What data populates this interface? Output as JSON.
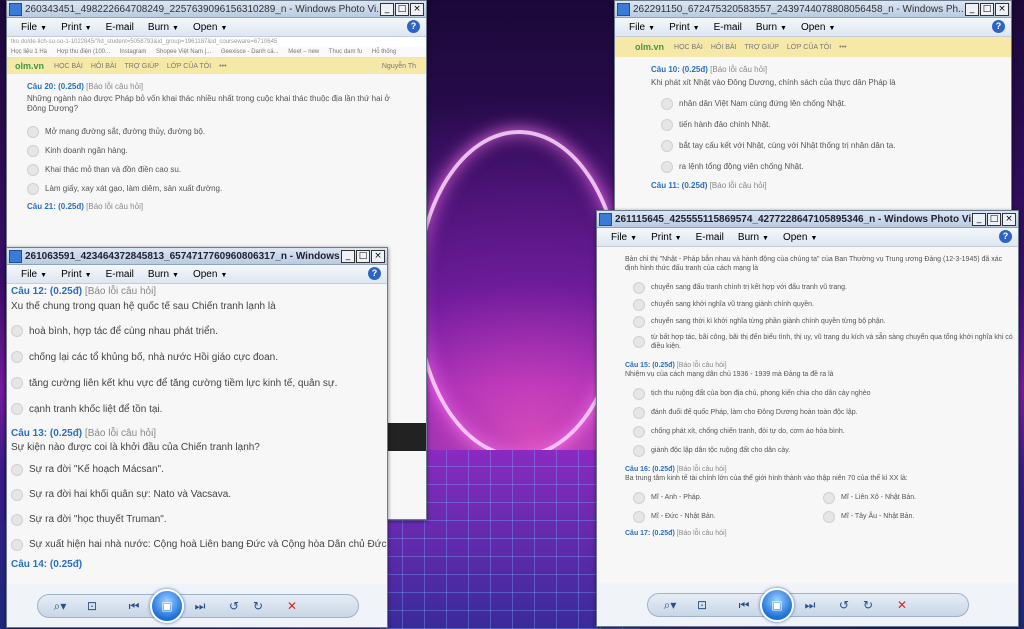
{
  "menu": {
    "file": "File",
    "print": "Print",
    "email": "E-mail",
    "burn": "Burn",
    "open": "Open",
    "help": "?"
  },
  "win1": {
    "title": "260343451_498222664708249_2257639096156310289_n - Windows Photo Vi...",
    "address": "tko do/de-lich-su-so-1-1022845/?id_student=5058793&id_group=1961187&id_courseware=6710645",
    "bookmarks": [
      "Học liệu 1 Hà",
      "Hợp thu điện (100...",
      "Instagram",
      "Shopee Việt Nam |...",
      "Geexisce - Danh cá...",
      "Meet – new",
      "Thuc dam fu",
      "Hỗ thống"
    ],
    "site": {
      "logo": "olm.vn",
      "items": [
        "HỌC BÀI",
        "HỎI BÀI",
        "TRỢ GIÚP",
        "LỚP CỦA TÔI",
        "•••"
      ],
      "user": "Nguyễn Th"
    },
    "q1_head": "Câu 20: (0.25đ)",
    "report": "[Báo lỗi câu hỏi]",
    "q1_text": "Những ngành nào được Pháp bỏ vốn khai thác nhiều nhất trong cuộc khai thác thuộc địa lần thứ hai ở Đông Dương?",
    "q1_opts": [
      "Mở mang đường sắt, đường thủy, đường bộ.",
      "Kinh doanh ngân hàng.",
      "Khai thác mỏ than và đồn điền cao su.",
      "Làm giấy, xay xát gạo, làm diêm, sản xuất đường."
    ],
    "q2_head": "Câu 21: (0.25đ)"
  },
  "win2": {
    "title": "261063591_423464372845813_6574717760960806317_n - Windows...",
    "q1_head": "Câu 12: (0.25đ)",
    "report": "[Báo lỗi câu hỏi]",
    "q1_text": "Xu thế chung trong quan hệ quốc tế sau Chiến tranh lạnh là",
    "q1_opts": [
      "hoà bình, hợp tác để cùng nhau phát triển.",
      "chống lại các tổ khủng bố, nhà nước Hồi giáo cực đoan.",
      "tăng cường liên kết khu vực để tăng cường tiềm lực kinh tế, quân sự.",
      "cạnh tranh khốc liệt để tồn tại."
    ],
    "q2_head": "Câu 13: (0.25đ)",
    "q2_text": "Sự kiện nào được coi là khởi đầu của Chiến tranh lạnh?",
    "q2_opts": [
      "Sự ra đời \"Kế hoạch Mácsan\".",
      "Sự ra đời hai khối quân sự: Nato và Vacsava.",
      "Sự ra đời \"học thuyết Truman\".",
      "Sự xuất hiện hai nhà nước: Cộng hoà Liên bang Đức và Cộng hòa Dân chủ Đức"
    ],
    "q3_head": "Câu 14: (0.25đ)"
  },
  "win3": {
    "title": "262291150_672475320583557_2439744078808056458_n - Windows Ph...",
    "site": {
      "logo": "olm.vn",
      "items": [
        "HỌC BÀI",
        "HỎI BÀI",
        "TRỢ GIÚP",
        "LỚP CỦA TÔI",
        "•••"
      ]
    },
    "q1_head": "Câu 10: (0.25đ)",
    "report": "[Báo lỗi câu hỏi]",
    "q1_text": "Khi phát xít Nhật vào Đông Dương, chính sách của thực dân Pháp là",
    "q1_opts": [
      "nhân dân Việt Nam cùng đứng lên chống Nhật.",
      "tiến hành đảo chính Nhật.",
      "bắt tay cấu kết với Nhật, cùng với Nhật thống trị nhân dân ta.",
      "ra lệnh tổng động viên chống Nhật."
    ],
    "q2_head": "Câu 11: (0.25đ)"
  },
  "win4": {
    "title": "261115645_425555115869574_4277228647105895346_n - Windows Photo Vi...",
    "intro": "Bản chỉ thị \"Nhật - Pháp bắn nhau và hành động của chúng ta\" của Ban Thường vụ Trung ương Đảng (12-3-1945) đã xác định hình thức đấu tranh của cách mạng là",
    "q0_opts": [
      "chuyển sang đấu tranh chính trị kết hợp với đấu tranh vũ trang.",
      "chuyển sang khởi nghĩa vũ trang giành chính quyền.",
      "chuyển sang thời kì khởi nghĩa từng phần giành chính quyền từng bộ phận.",
      "từ bất hợp tác, bãi công, bãi thị đến biểu tình, thị uy, vũ trang du kích và sẵn sàng chuyển qua tổng khởi nghĩa khi có điều kiện."
    ],
    "q1_head": "Câu 15: (0.25đ)",
    "report": "[Báo lỗi câu hỏi]",
    "q1_text": "Nhiệm vụ của cách mạng dân chủ 1936 - 1939 mà Đảng ta đề ra là",
    "q1_opts": [
      "tịch thu ruộng đất của bọn địa chủ, phong kiến chia cho dân cày nghèo",
      "đánh đuổi đế quốc Pháp, làm cho Đông Dương hoàn toàn độc lập.",
      "chống phát xít, chống chiến tranh, đòi tự do, cơm áo hòa bình.",
      "giành độc lập dân tộc ruộng đất cho dân cày."
    ],
    "q2_head": "Câu 16: (0.25đ)",
    "q2_text": "Ba trung tâm kinh tế tài chính lớn của thế giới hình thành vào thập niên 70 của thế kỉ XX là:",
    "q2_opts": [
      "Mĩ - Anh - Pháp.",
      "Mĩ - Liên Xô - Nhật Bản.",
      "Mĩ - Đức - Nhật Bản.",
      "Mĩ - Tây Âu - Nhật Bản."
    ],
    "q3_head": "Câu 17: (0.25đ)"
  },
  "toolbar_icons": [
    "zoom-icon",
    "fit-icon",
    "previous-icon",
    "slideshow-icon",
    "next-icon",
    "rotate-left-icon",
    "rotate-right-icon",
    "delete-icon"
  ]
}
